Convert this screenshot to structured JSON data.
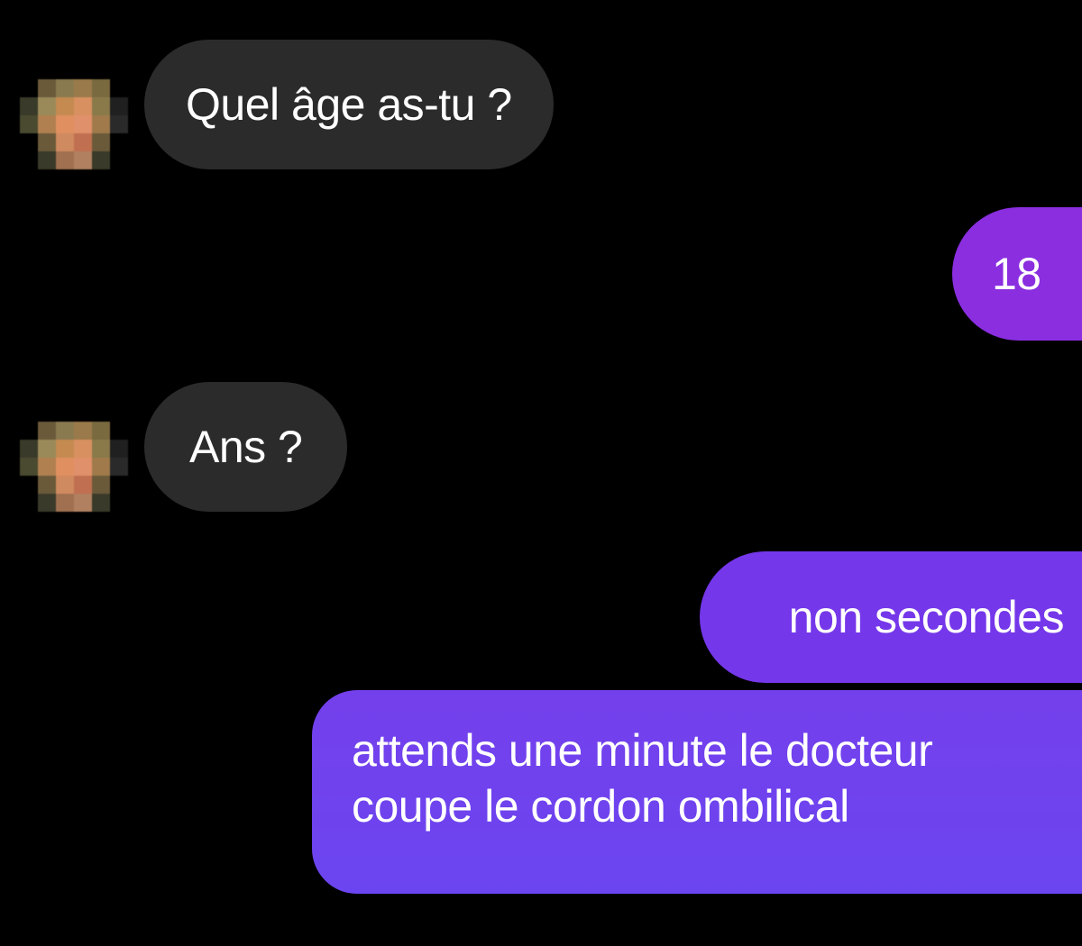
{
  "conversation": {
    "messages": [
      {
        "from": "contact",
        "text": "Quel âge as-tu ?"
      },
      {
        "from": "me",
        "text": "18"
      },
      {
        "from": "contact",
        "text": "Ans ?"
      },
      {
        "from": "me",
        "text": "non secondes"
      },
      {
        "from": "me",
        "lines": [
          "attends une minute le docteur",
          "coupe le cordon ombilical"
        ]
      }
    ]
  },
  "colors": {
    "background": "#000000",
    "received_bubble": "#2b2b2b",
    "sent_bubble": "#7537ea",
    "text": "#ffffff"
  },
  "icons": {
    "avatar": "pixelated-avatar"
  }
}
